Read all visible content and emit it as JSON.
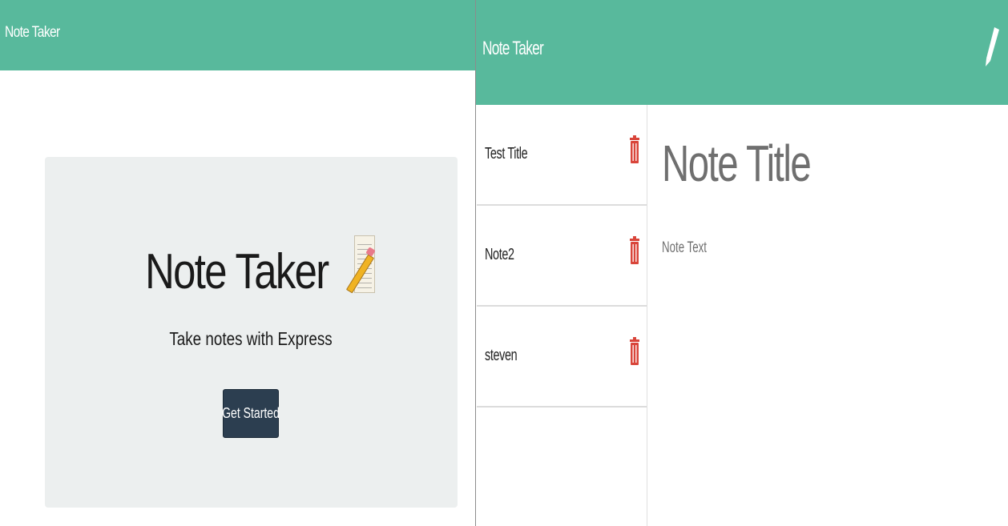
{
  "landing": {
    "brand": "Note Taker",
    "title": "Note Taker",
    "subtitle": "Take notes with Express",
    "button_label": "Get Started",
    "icon": "memo-icon"
  },
  "notes_page": {
    "brand": "Note Taker",
    "new_note_icon": "pencil-icon",
    "notes": [
      {
        "title": "Test Title",
        "delete_icon": "trash-icon"
      },
      {
        "title": "Note2",
        "delete_icon": "trash-icon"
      },
      {
        "title": "steven",
        "delete_icon": "trash-icon"
      }
    ],
    "editor": {
      "title_placeholder": "Note Title",
      "text_placeholder": "Note Text"
    }
  },
  "colors": {
    "navbar": "#58b99c",
    "jumbotron": "#ecefef",
    "button": "#2c3e50",
    "trash": "#d9453a",
    "placeholder": "#6f6f6f"
  }
}
